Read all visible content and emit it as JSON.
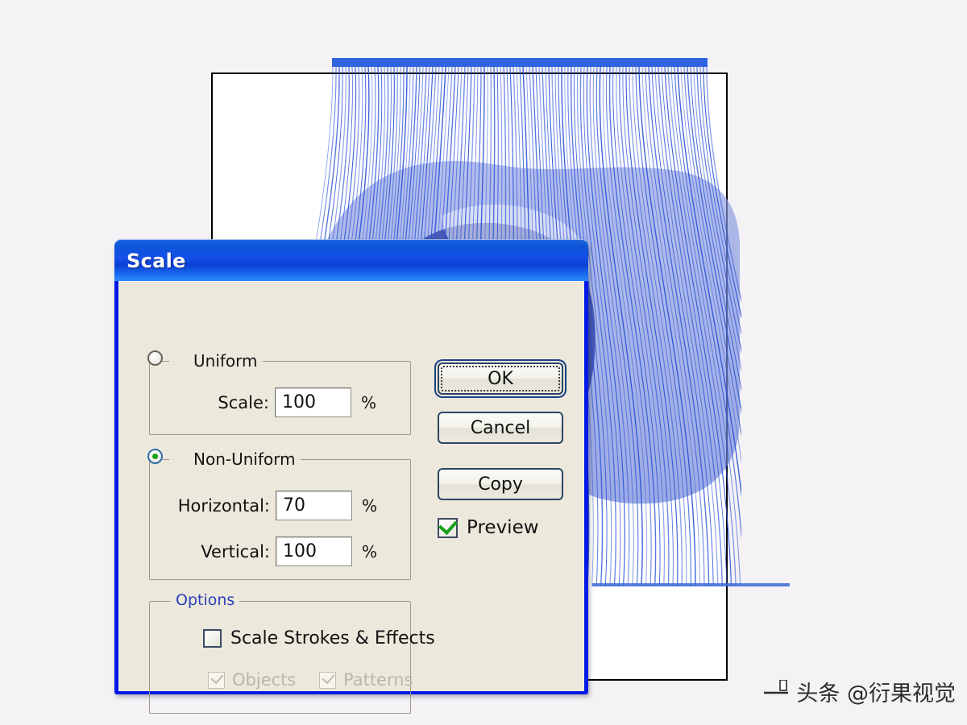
{
  "background": {
    "color": "#f4f2f5"
  },
  "canvas": {
    "artboard": {
      "name": "artboard"
    },
    "artwork": {
      "name": "blend-line-art",
      "stroke_color": "#2a52d8",
      "bar_color": "#2f63e0",
      "blob_color": "#7a8ede"
    }
  },
  "dialog": {
    "title": "Scale",
    "accent_color": "#0019e6",
    "body_color": "#ece9dc",
    "uniform": {
      "legend": "Uniform",
      "selected": false,
      "scale": {
        "label": "Scale:",
        "value": "100",
        "unit": "%"
      }
    },
    "non_uniform": {
      "legend": "Non-Uniform",
      "selected": true,
      "horizontal": {
        "label": "Horizontal:",
        "value": "70",
        "unit": "%"
      },
      "vertical": {
        "label": "Vertical:",
        "value": "100",
        "unit": "%"
      }
    },
    "options": {
      "legend": "Options",
      "legend_color": "#2b3fb5",
      "scale_strokes": {
        "label": "Scale Strokes & Effects",
        "checked": false,
        "enabled": true
      },
      "objects": {
        "label": "Objects",
        "checked": true,
        "enabled": false
      },
      "patterns": {
        "label": "Patterns",
        "checked": true,
        "enabled": false
      }
    },
    "buttons": {
      "ok": "OK",
      "cancel": "Cancel",
      "copy": "Copy"
    },
    "preview": {
      "label": "Preview",
      "checked": true
    }
  },
  "watermark": {
    "text": "头条 @衍果视觉"
  }
}
